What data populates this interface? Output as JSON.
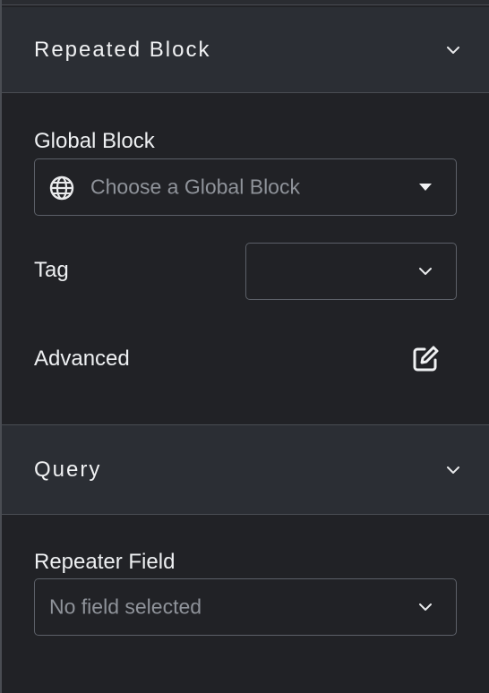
{
  "repeated_block": {
    "title": "Repeated Block",
    "toggle_icon": "chevron-down-icon"
  },
  "global_block": {
    "label": "Global Block",
    "placeholder": "Choose a Global Block",
    "icon": "globe-icon",
    "caret_icon": "caret-down-icon"
  },
  "tag": {
    "label": "Tag",
    "value": "",
    "caret_icon": "chevron-down-icon"
  },
  "advanced": {
    "label": "Advanced",
    "icon": "edit-icon"
  },
  "query": {
    "title": "Query",
    "toggle_icon": "chevron-down-icon"
  },
  "repeater_field": {
    "label": "Repeater Field",
    "placeholder": "No field selected",
    "caret_icon": "chevron-down-icon"
  }
}
